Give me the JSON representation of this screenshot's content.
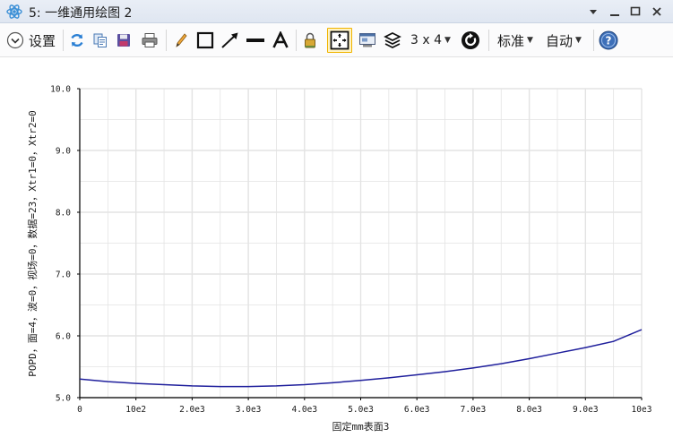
{
  "window": {
    "title": "5: 一维通用绘图 2",
    "icon": "atom-icon"
  },
  "toolbar": {
    "settings_label": "设置",
    "grid_label": "3 x 4",
    "standard_label": "标准",
    "auto_label": "自动",
    "icons": [
      "refresh-icon",
      "copy-icon",
      "save-icon",
      "print-icon",
      "pencil-icon",
      "rectangle-icon",
      "arrow-icon",
      "line-icon",
      "text-icon",
      "lock-icon",
      "fit-icon",
      "window-icon",
      "layers-icon",
      "rotate-icon",
      "help-icon"
    ]
  },
  "colors": {
    "curve": "#1f1f9c",
    "grid": "#e3e3e3",
    "axis": "#000000",
    "active_border": "#f0b400"
  },
  "chart_data": {
    "type": "line",
    "xlabel": "固定mm表面3",
    "ylabel": "POPD，面=4，波=0，视场=0，数据=23，Xtr1=0，Xtr2=0",
    "x_ticks": [
      "0",
      "10e2",
      "2.0e3",
      "3.0e3",
      "4.0e3",
      "5.0e3",
      "6.0e3",
      "7.0e3",
      "8.0e3",
      "9.0e3",
      "10e3"
    ],
    "y_ticks": [
      "5.0",
      "6.0",
      "7.0",
      "8.0",
      "9.0",
      "10.0"
    ],
    "xlim": [
      0,
      10000
    ],
    "ylim": [
      5.0,
      10.0
    ],
    "grid": true,
    "series": [
      {
        "x": [
          0,
          500,
          1000,
          1500,
          2000,
          2500,
          3000,
          3500,
          4000,
          4500,
          5000,
          5500,
          6000,
          6500,
          7000,
          7500,
          8000,
          8500,
          9000,
          9500,
          10000
        ],
        "values": [
          5.3,
          5.26,
          5.23,
          5.21,
          5.19,
          5.18,
          5.18,
          5.19,
          5.21,
          5.24,
          5.28,
          5.32,
          5.37,
          5.42,
          5.48,
          5.55,
          5.63,
          5.72,
          5.81,
          5.91,
          6.1
        ]
      }
    ]
  }
}
